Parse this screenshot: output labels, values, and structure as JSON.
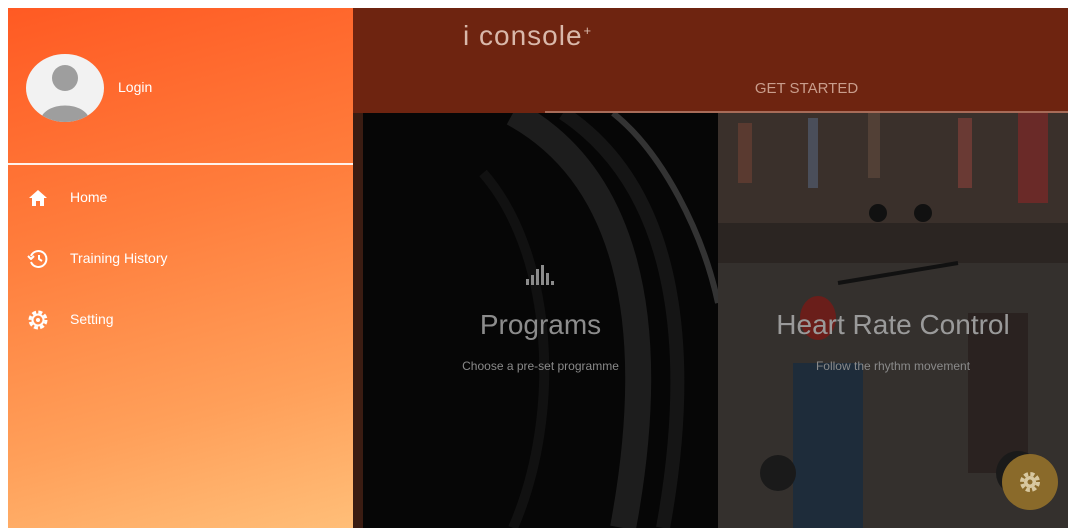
{
  "drawer": {
    "login_label": "Login",
    "items": [
      {
        "label": "Home",
        "icon": "home-icon"
      },
      {
        "label": "Training History",
        "icon": "history-icon"
      },
      {
        "label": "Setting",
        "icon": "settings-icon"
      }
    ],
    "gradient_colors": [
      "#ff5a23",
      "#ffbe78"
    ]
  },
  "topbar": {
    "brand": "i console",
    "brand_mark": "+",
    "tab_label": "GET STARTED",
    "background": "#6e2410"
  },
  "cards": [
    {
      "title": "Programs",
      "subtitle": "Choose a pre-set programme",
      "icon": "bars-icon"
    },
    {
      "title": "Heart Rate Control",
      "subtitle": "Follow the rhythm movement",
      "icon": "heart-photo"
    }
  ],
  "fab": {
    "icon": "gear-icon",
    "color": "#8a6a2a"
  }
}
